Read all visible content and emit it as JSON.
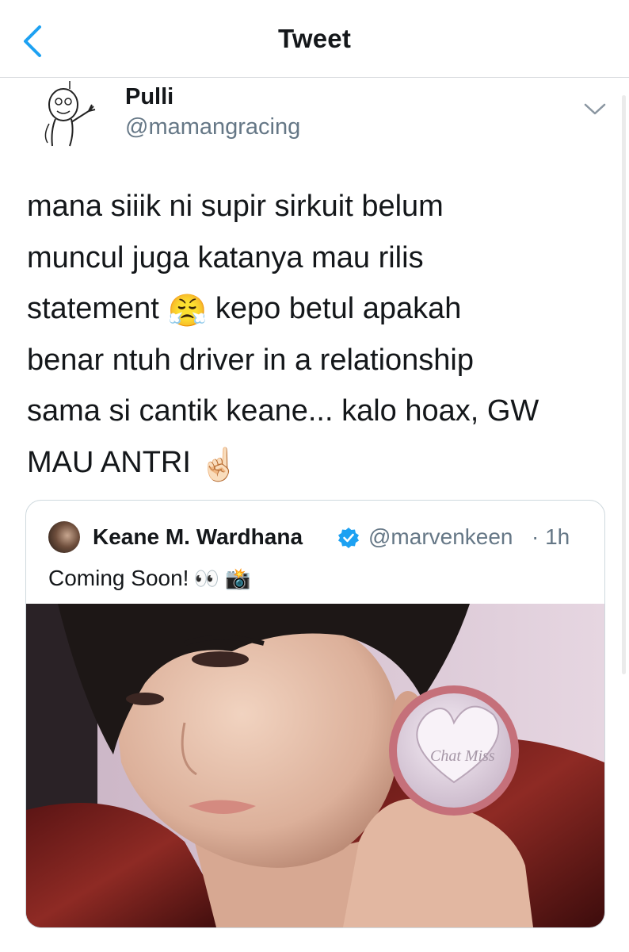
{
  "header": {
    "title": "Tweet"
  },
  "tweet": {
    "display_name": "Pulli",
    "handle": "@mamangracing",
    "line_1": "mana siiik ni supir sirkuit belum",
    "line_2": "muncul juga katanya mau rilis",
    "line_3_start": "statement",
    "emoji_1": "😤",
    "line_3_end": "kepo betul apakah",
    "line_4": "benar ntuh driver in a relationship",
    "line_5": "sama si cantik keane... kalo hoax, GW",
    "line_6": "MAU ANTRI",
    "emoji_2": "☝🏻"
  },
  "quoted_tweet": {
    "display_name": "Keane M. Wardhana",
    "handle": "@marvenkeen",
    "time": "· 1h",
    "text": "Coming Soon!",
    "emoji": "👀 📸",
    "image_product_text": "Chat Miss"
  },
  "colors": {
    "accent": "#1da1f2",
    "secondary_text": "#657786",
    "border": "#cfd9de"
  },
  "icons": {
    "back": "chevron-left-icon",
    "more": "chevron-down-icon",
    "verified": "verified-badge-icon"
  }
}
